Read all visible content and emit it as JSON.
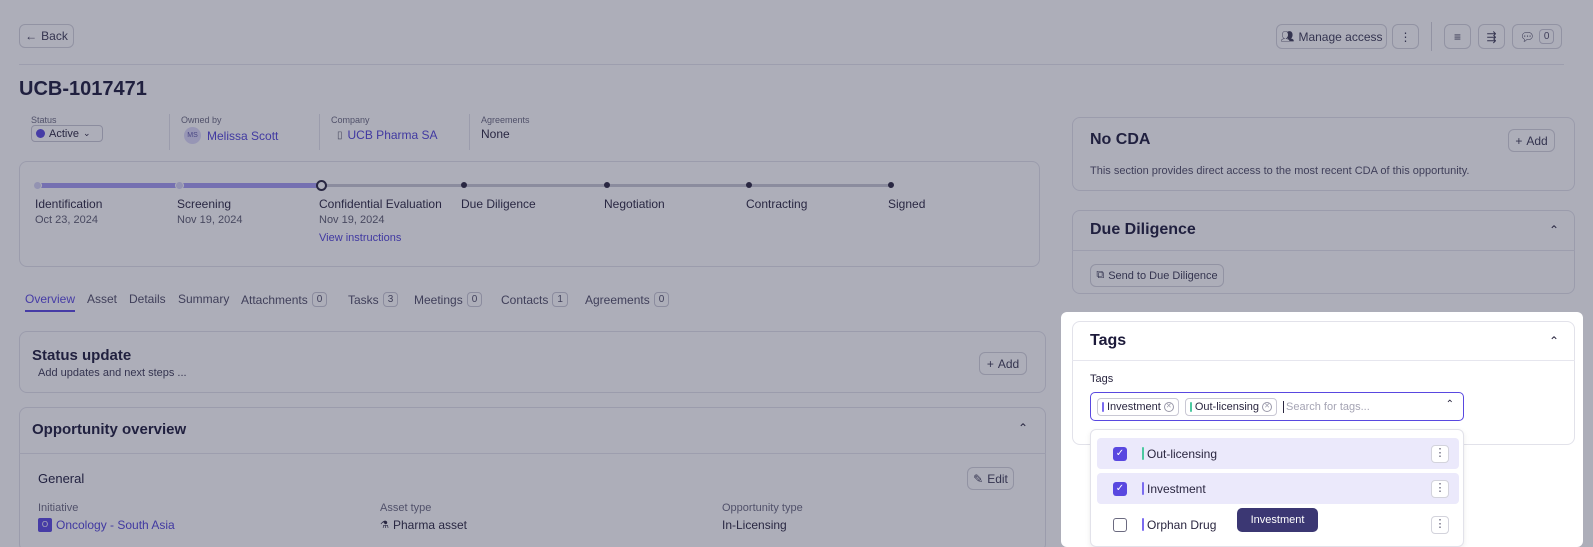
{
  "topbar": {
    "back_label": "Back",
    "manage_access_label": "Manage access",
    "comments_count": "0"
  },
  "title": "UCB-1017471",
  "meta": {
    "status_label": "Status",
    "status_value": "Active",
    "owner_label": "Owned by",
    "owner_initials": "MS",
    "owner_name": "Melissa Scott",
    "company_label": "Company",
    "company_name": "UCB Pharma SA",
    "agreements_label": "Agreements",
    "agreements_value": "None"
  },
  "stages": [
    {
      "name": "Identification",
      "date": "Oct 23, 2024"
    },
    {
      "name": "Screening",
      "date": "Nov 19, 2024"
    },
    {
      "name": "Confidential Evaluation",
      "date": "Nov 19, 2024",
      "link": "View instructions"
    },
    {
      "name": "Due Diligence",
      "date": ""
    },
    {
      "name": "Negotiation",
      "date": ""
    },
    {
      "name": "Contracting",
      "date": ""
    },
    {
      "name": "Signed",
      "date": ""
    }
  ],
  "tabs": [
    {
      "label": "Overview",
      "count": ""
    },
    {
      "label": "Asset",
      "count": ""
    },
    {
      "label": "Details",
      "count": ""
    },
    {
      "label": "Summary",
      "count": ""
    },
    {
      "label": "Attachments",
      "count": "0"
    },
    {
      "label": "Tasks",
      "count": "3"
    },
    {
      "label": "Meetings",
      "count": "0"
    },
    {
      "label": "Contacts",
      "count": "1"
    },
    {
      "label": "Agreements",
      "count": "0"
    }
  ],
  "status_update": {
    "title": "Status update",
    "subtitle": "Add updates and next steps ...",
    "add_label": "Add"
  },
  "overview": {
    "title": "Opportunity overview",
    "section": "General",
    "edit_label": "Edit",
    "initiative_label": "Initiative",
    "initiative_badge": "O",
    "initiative_value": "Oncology - South Asia",
    "asset_type_label": "Asset type",
    "asset_type_value": "Pharma asset",
    "opp_type_label": "Opportunity type",
    "opp_type_value": "In-Licensing"
  },
  "cda": {
    "title": "No CDA",
    "add_label": "Add",
    "description": "This section provides direct access to the most recent CDA of this opportunity."
  },
  "due_diligence": {
    "title": "Due Diligence",
    "send_label": "Send to Due Diligence"
  },
  "tags": {
    "title": "Tags",
    "field_label": "Tags",
    "placeholder": "Search for tags...",
    "selected": [
      {
        "label": "Investment",
        "color": "#7b6cf0"
      },
      {
        "label": "Out-licensing",
        "color": "#4cc9a0"
      }
    ],
    "options": [
      {
        "label": "Out-licensing",
        "checked": true,
        "color": "#4cc9a0"
      },
      {
        "label": "Investment",
        "checked": true,
        "color": "#7b6cf0"
      },
      {
        "label": "Orphan Drug",
        "checked": false,
        "color": "#7b6cf0"
      }
    ],
    "tooltip": "Investment"
  },
  "colors": {
    "accent": "#5948e0",
    "overlay": "rgba(40,42,70,0.38)",
    "progress": "#a59cf2"
  }
}
